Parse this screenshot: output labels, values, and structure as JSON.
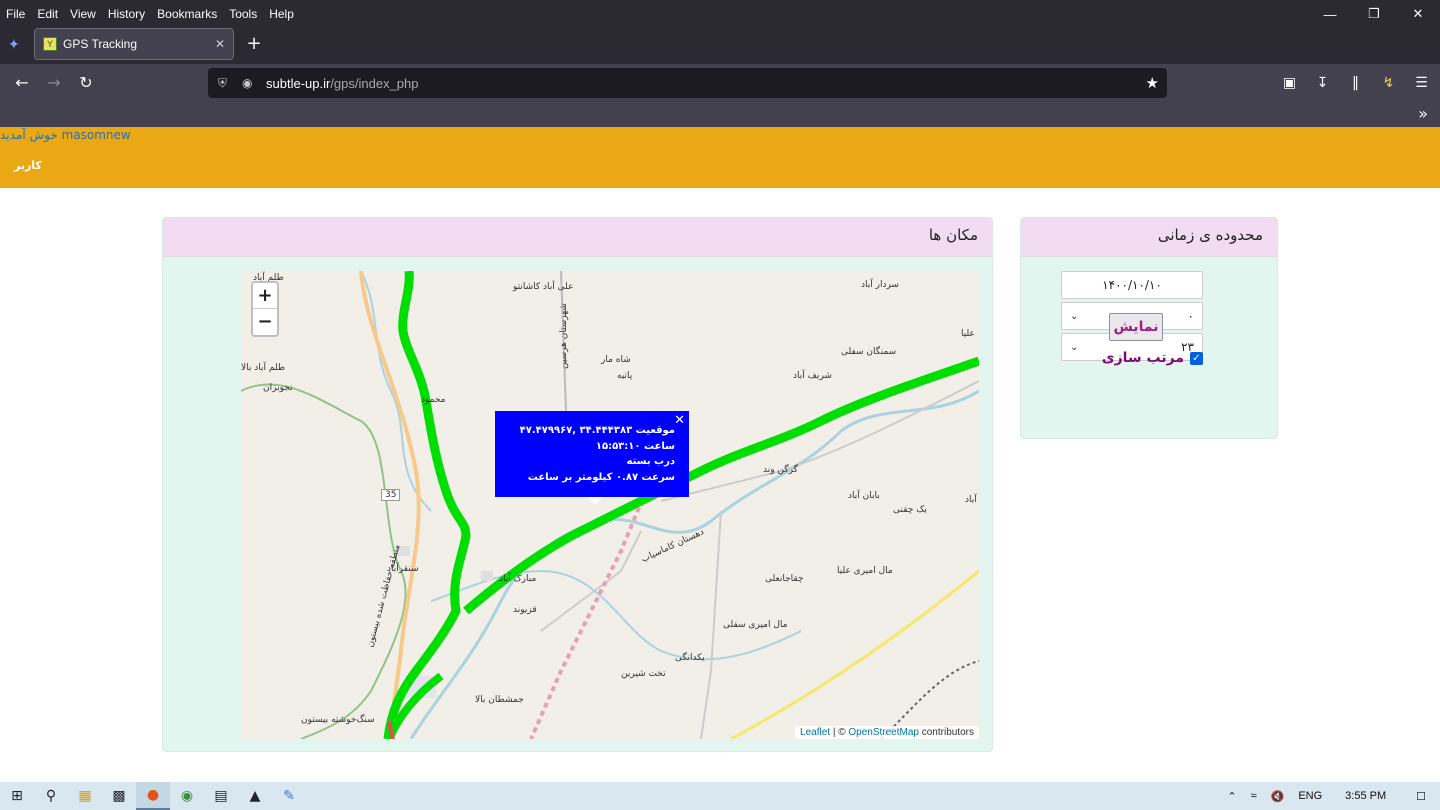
{
  "browser": {
    "menu": [
      "File",
      "Edit",
      "View",
      "History",
      "Bookmarks",
      "Tools",
      "Help"
    ],
    "tab_title": "GPS Tracking",
    "url_host": "subtle-up.ir",
    "url_path": "/gps/index_php"
  },
  "header": {
    "username": "masomnew",
    "welcome_text": "خوش آمدید",
    "nav_user": "کاربر"
  },
  "map_panel": {
    "title": "مکان ها",
    "popup": {
      "line1": "موقعیت ۳۴.۴۴۴۳۸۳ ,۴۷.۴۷۹۹۶۷",
      "line2": "ساعت ۱۵:۵۳:۱۰",
      "line3": "درب بسته",
      "line4": "سرعت ۰.۸۷ کیلومتر بر ساعت"
    },
    "attribution_leaflet": "Leaflet",
    "attribution_sep": " | © ",
    "attribution_osm": "OpenStreetMap",
    "attribution_tail": " contributors",
    "road_number": "35",
    "places": [
      "طلم آباد",
      "علی آباد کاشانتو",
      "سردار آباد",
      "علیا",
      "شاه مار",
      "سمنگان سفلی",
      "پاتیه",
      "شریف آباد",
      "طلم آباد بالا",
      "نجوبران",
      "محمود",
      "گرگن وند",
      "بابان آباد",
      "یک چقنی",
      "آباد",
      "سنقرآباد",
      "مبارک آباد",
      "قزیوند",
      "چقاجانعلی",
      "مال امیری علیا",
      "مال امیری سفلی",
      "یکدانگی",
      "تخت شیرین",
      "جمشطان بالا",
      "سنگ‌خوشته بیستون",
      "دهستان کاماسیاب",
      "شهرستان هرسین",
      "منطقه حفاظت شده بیستون"
    ]
  },
  "range_panel": {
    "title": "محدوده ی زمانی",
    "date_value": "۱۴۰۰/۱۰/۱۰",
    "hour_from": "۰",
    "hour_to": "۲۳",
    "show_button": "نمایش",
    "sort_label": "مرتب سازی",
    "sort_checked": true
  },
  "taskbar": {
    "lang": "ENG",
    "time": "3:55 PM"
  },
  "colors": {
    "nav": "#eaa914",
    "panel_header": "#f1dcf2",
    "panel_body": "#e2f5ef",
    "track": "#00dd00",
    "popup": "#0000ff"
  }
}
